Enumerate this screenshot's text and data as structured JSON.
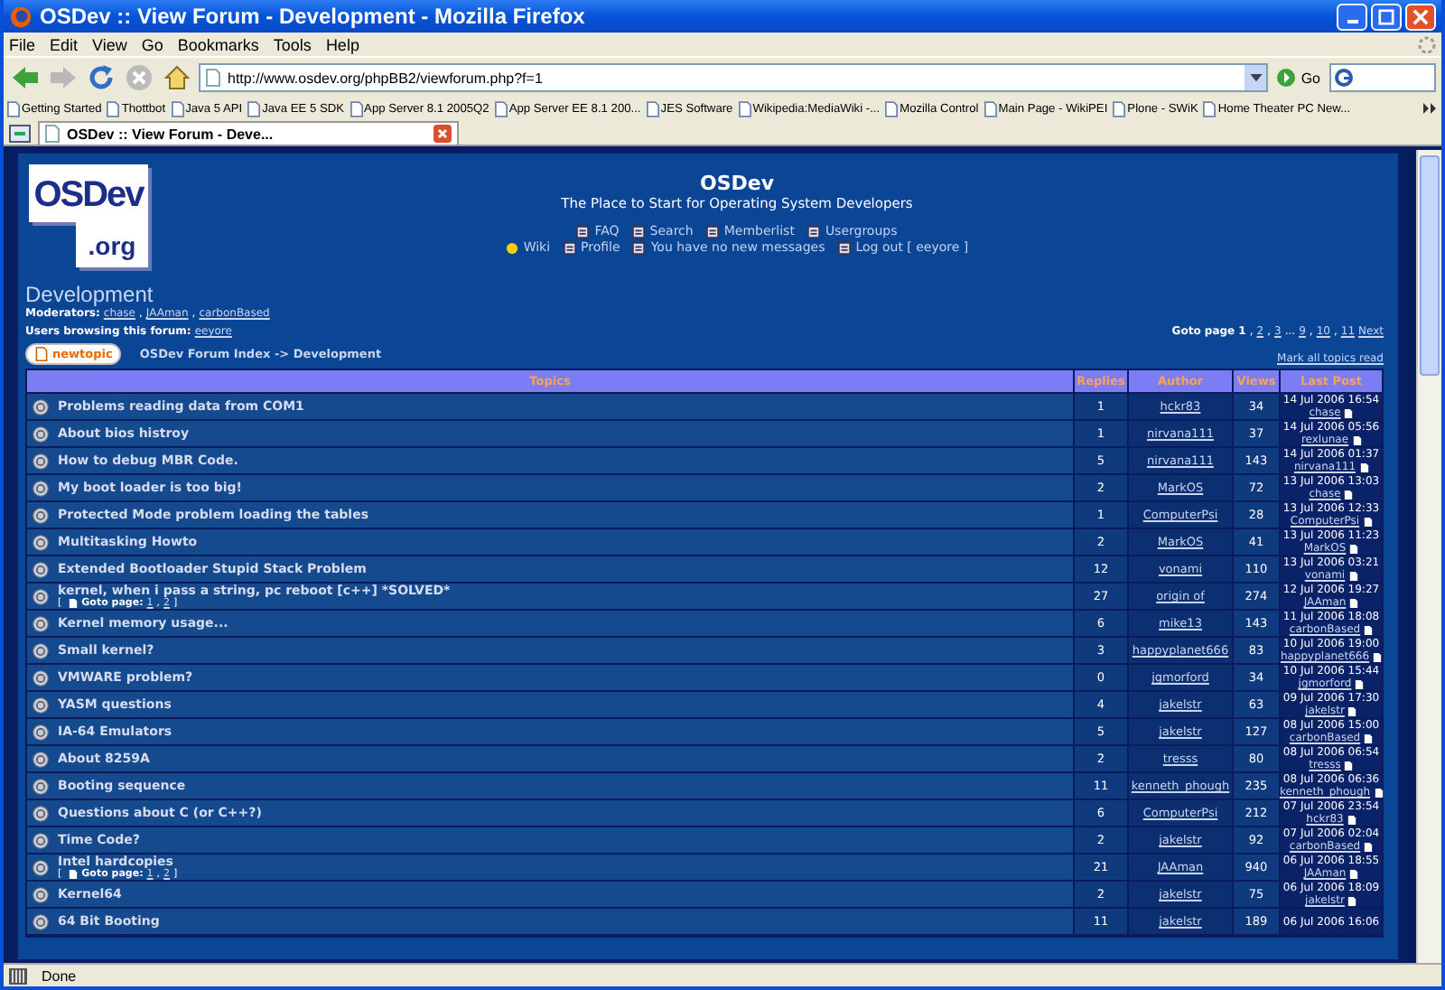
{
  "window": {
    "title": "OSDev :: View Forum - Development - Mozilla Firefox"
  },
  "menu": [
    "File",
    "Edit",
    "View",
    "Go",
    "Bookmarks",
    "Tools",
    "Help"
  ],
  "toolbar": {
    "url": "http://www.osdev.org/phpBB2/viewforum.php?f=1",
    "go": "Go"
  },
  "bookmarks": [
    "Getting Started",
    "Thottbot",
    "Java 5 API",
    "Java EE 5 SDK",
    "App Server 8.1 2005Q2",
    "App Server EE 8.1 200...",
    "JES Software",
    "Wikipedia:MediaWiki -...",
    "Mozilla Control",
    "Main Page - WikiPEI",
    "Plone - SWiK",
    "Home Theater PC New..."
  ],
  "tabs": [
    {
      "label": "OSDev :: View Forum - Deve...",
      "selected": true
    }
  ],
  "header": {
    "logo_main": "OSDev",
    "logo_sub": ".org",
    "site_title": "OSDev",
    "tagline": "The Place to Start for Operating System Developers",
    "nav_rows": [
      [
        {
          "kind": "page",
          "label": "FAQ"
        },
        {
          "kind": "page",
          "label": "Search"
        },
        {
          "kind": "page",
          "label": "Memberlist"
        },
        {
          "kind": "page",
          "label": "Usergroups"
        }
      ],
      [
        {
          "kind": "wiki",
          "label": "Wiki"
        },
        {
          "kind": "page",
          "label": "Profile"
        },
        {
          "kind": "page",
          "label": "You have no new messages"
        },
        {
          "kind": "page",
          "label": "Log out [ eeyore ]"
        }
      ]
    ]
  },
  "forum": {
    "title": "Development",
    "moderators_label": "Moderators:",
    "moderators": [
      {
        "name": "chase",
        "after": ","
      },
      {
        "name": "JAAman",
        "after": ","
      },
      {
        "name": "carbonBased"
      }
    ],
    "browsing_label": "Users browsing this forum:",
    "browsing": [
      "eeyore"
    ],
    "goto": {
      "label": "Goto page",
      "pages": [
        {
          "text": "1",
          "selected": true,
          "after": ", "
        },
        {
          "text": "2",
          "selected": false,
          "after": ", "
        },
        {
          "text": "3",
          "selected": false,
          "after": " ... "
        },
        {
          "text": "9",
          "selected": false,
          "after": ", "
        },
        {
          "text": "10",
          "selected": false,
          "after": ", "
        },
        {
          "text": "11",
          "selected": false
        }
      ],
      "next": "Next"
    },
    "new_topic": "newtopic",
    "breadcrumb": "OSDev Forum Index -> Development",
    "mark_read": "Mark all topics read"
  },
  "table": {
    "columns": [
      "Topics",
      "Replies",
      "Author",
      "Views",
      "Last Post"
    ],
    "rows": [
      {
        "topic": "Problems reading data from COM1",
        "replies": "1",
        "author": "hckr83",
        "views": "34",
        "last_date": "14 Jul 2006 16:54",
        "last_by": "chase"
      },
      {
        "topic": "About bios histroy",
        "replies": "1",
        "author": "nirvana111",
        "views": "37",
        "last_date": "14 Jul 2006 05:56",
        "last_by": "rexlunae"
      },
      {
        "topic": "How to debug MBR Code.",
        "replies": "5",
        "author": "nirvana111",
        "views": "143",
        "last_date": "14 Jul 2006 01:37",
        "last_by": "nirvana111"
      },
      {
        "topic": "My boot loader is too big!",
        "replies": "2",
        "author": "MarkOS",
        "views": "72",
        "last_date": "13 Jul 2006 13:03",
        "last_by": "chase"
      },
      {
        "topic": "Protected Mode problem loading the tables",
        "replies": "1",
        "author": "ComputerPsi",
        "views": "28",
        "last_date": "13 Jul 2006 12:33",
        "last_by": "ComputerPsi"
      },
      {
        "topic": "Multitasking Howto",
        "replies": "2",
        "author": "MarkOS",
        "views": "41",
        "last_date": "13 Jul 2006 11:23",
        "last_by": "MarkOS"
      },
      {
        "topic": "Extended Bootloader Stupid Stack Problem",
        "replies": "12",
        "author": "vonami",
        "views": "110",
        "last_date": "13 Jul 2006 03:21",
        "last_by": "vonami"
      },
      {
        "topic": "kernel, when i pass a string, pc reboot [c++] *SOLVED*",
        "replies": "27",
        "author": "origin of",
        "views": "274",
        "last_date": "12 Jul 2006 19:27",
        "last_by": "JAAman",
        "goto": {
          "open": "[",
          "label": "Goto page:",
          "pages": [
            {
              "text": "1",
              "after": ","
            },
            {
              "text": "2"
            }
          ],
          "close": "]"
        }
      },
      {
        "topic": "Kernel memory usage...",
        "replies": "6",
        "author": "mike13",
        "views": "143",
        "last_date": "11 Jul 2006 18:08",
        "last_by": "carbonBased"
      },
      {
        "topic": "Small kernel?",
        "replies": "3",
        "author": "happyplanet666",
        "views": "83",
        "last_date": "10 Jul 2006 19:00",
        "last_by": "happyplanet666"
      },
      {
        "topic": "VMWARE problem?",
        "replies": "0",
        "author": "jgmorford",
        "views": "34",
        "last_date": "10 Jul 2006 15:44",
        "last_by": "jgmorford"
      },
      {
        "topic": "YASM questions",
        "replies": "4",
        "author": "jakelstr",
        "views": "63",
        "last_date": "09 Jul 2006 17:30",
        "last_by": "jakelstr"
      },
      {
        "topic": "IA-64 Emulators",
        "replies": "5",
        "author": "jakelstr",
        "views": "127",
        "last_date": "08 Jul 2006 15:00",
        "last_by": "carbonBased"
      },
      {
        "topic": "About 8259A",
        "replies": "2",
        "author": "tresss",
        "views": "80",
        "last_date": "08 Jul 2006 06:54",
        "last_by": "tresss"
      },
      {
        "topic": "Booting sequence",
        "replies": "11",
        "author": "kenneth_phough",
        "views": "235",
        "last_date": "08 Jul 2006 06:36",
        "last_by": "kenneth_phough"
      },
      {
        "topic": "Questions about C (or C++?)",
        "replies": "6",
        "author": "ComputerPsi",
        "views": "212",
        "last_date": "07 Jul 2006 23:54",
        "last_by": "hckr83"
      },
      {
        "topic": "Time Code?",
        "replies": "2",
        "author": "jakelstr",
        "views": "92",
        "last_date": "07 Jul 2006 02:04",
        "last_by": "carbonBased"
      },
      {
        "topic": "Intel hardcopies",
        "replies": "21",
        "author": "JAAman",
        "views": "940",
        "last_date": "06 Jul 2006 18:55",
        "last_by": "JAAman",
        "goto": {
          "open": "[",
          "label": "Goto page:",
          "pages": [
            {
              "text": "1",
              "after": ","
            },
            {
              "text": "2"
            }
          ],
          "close": "]"
        }
      },
      {
        "topic": "Kernel64",
        "replies": "2",
        "author": "jakelstr",
        "views": "75",
        "last_date": "06 Jul 2006 18:09",
        "last_by": "jakelstr"
      },
      {
        "topic": "64 Bit Booting",
        "replies": "11",
        "author": "jakelstr",
        "views": "189",
        "last_date": "06 Jul 2006 16:06"
      }
    ]
  },
  "status_bar": {
    "text": "Done"
  }
}
